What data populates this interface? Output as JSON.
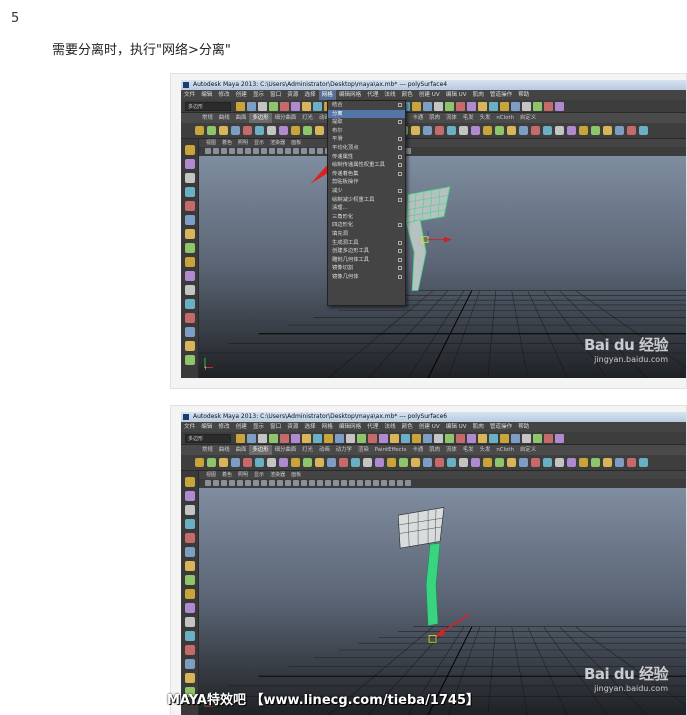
{
  "step_number": "5",
  "instruction": "需要分离时，执行\"网络>分离\"",
  "screenshots": [
    {
      "title": "Autodesk Maya 2013: C:\\Users\\Administrator\\Desktop\\maya\\ax.mb* --- polySurface4",
      "menubar": [
        "文件",
        "编辑",
        "修改",
        "创建",
        "显示",
        "窗口",
        "资源",
        "选择",
        "网格",
        "编辑网格",
        "代理",
        "法线",
        "颜色",
        "创建 UV",
        "编辑 UV",
        "肌肉",
        "管道操作",
        "帮助"
      ],
      "active_menu": "网格",
      "mode": "多边形",
      "shelf_tabs": [
        "常规",
        "曲线",
        "曲面",
        "多边形",
        "细分曲面",
        "灯光",
        "动画",
        "动力学",
        "渲染",
        "PaintEffects",
        "卡通",
        "肌肉",
        "流体",
        "毛发",
        "头发",
        "nCloth",
        "自定义"
      ],
      "active_shelf_tab": "多边形",
      "panel_menu": [
        "视图",
        "着色",
        "照明",
        "显示",
        "渲染器",
        "面板"
      ],
      "dropdown": [
        {
          "label": "结合",
          "opt": true
        },
        {
          "label": "分离",
          "opt": false,
          "highlight": true
        },
        {
          "label": "提取",
          "opt": true
        },
        {
          "label": "布尔",
          "opt": false
        },
        {
          "label": "平滑",
          "opt": true
        },
        {
          "label": "平均化顶点",
          "opt": true
        },
        {
          "label": "传递属性",
          "opt": true
        },
        {
          "label": "绘制传递属性权重工具",
          "opt": true
        },
        {
          "label": "传递着色集",
          "opt": true
        },
        {
          "label": "剪贴板操作",
          "opt": false
        },
        {
          "label": "减少",
          "opt": true
        },
        {
          "label": "绘制减少权重工具",
          "opt": true
        },
        {
          "label": "清理...",
          "opt": false
        },
        {
          "label": "三角形化",
          "opt": false
        },
        {
          "label": "四边形化",
          "opt": true
        },
        {
          "label": "填充洞",
          "opt": false
        },
        {
          "label": "生成洞工具",
          "opt": true
        },
        {
          "label": "创建多边形工具",
          "opt": true
        },
        {
          "label": "雕刻几何体工具",
          "opt": true
        },
        {
          "label": "镜像切割",
          "opt": true
        },
        {
          "label": "镜像几何体",
          "opt": true
        }
      ]
    },
    {
      "title": "Autodesk Maya 2013: C:\\Users\\Administrator\\Desktop\\maya\\ax.mb* --- polySurface6",
      "menubar": [
        "文件",
        "编辑",
        "修改",
        "创建",
        "显示",
        "窗口",
        "资源",
        "选择",
        "网格",
        "编辑网格",
        "代理",
        "法线",
        "颜色",
        "创建 UV",
        "编辑 UV",
        "肌肉",
        "管道操作",
        "帮助"
      ],
      "active_menu": "",
      "mode": "多边形",
      "shelf_tabs": [
        "常规",
        "曲线",
        "曲面",
        "多边形",
        "细分曲面",
        "灯光",
        "动画",
        "动力学",
        "渲染",
        "PaintEffects",
        "卡通",
        "肌肉",
        "流体",
        "毛发",
        "头发",
        "nCloth",
        "自定义"
      ],
      "active_shelf_tab": "多边形",
      "panel_menu": [
        "视图",
        "着色",
        "照明",
        "显示",
        "渲染器",
        "面板"
      ]
    }
  ],
  "watermark": {
    "logo": "Bai du 经验",
    "url": "jingyan.baidu.com"
  },
  "credit": "MAYA特效吧 【www.linecg.com/tieba/1745】",
  "colors": {
    "accent_menu": "#5475a8",
    "mesh_selected": "#3bd68a",
    "arrow": "#e0201e"
  }
}
